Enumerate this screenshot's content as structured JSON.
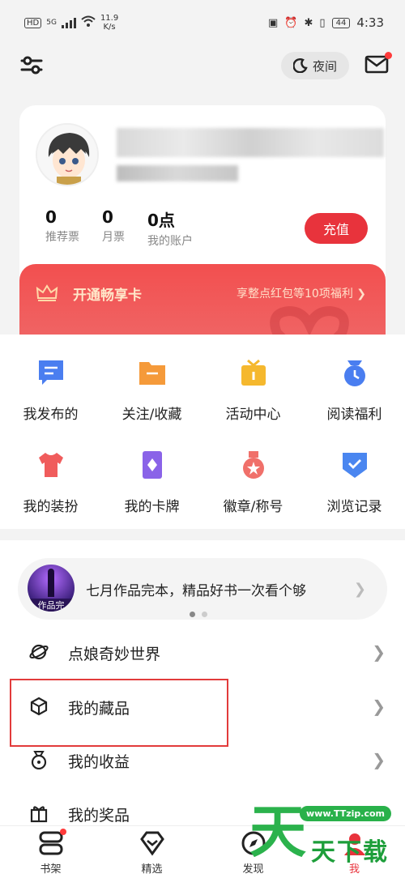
{
  "status_bar": {
    "hd": "HD",
    "network": "5G",
    "speed_value": "11.9",
    "speed_unit": "K/s",
    "battery": "44",
    "time": "4:33"
  },
  "topbar": {
    "night_label": "夜间",
    "mail_has_badge": true
  },
  "profile": {
    "stats": [
      {
        "value": "0",
        "label": "推荐票"
      },
      {
        "value": "0",
        "label": "月票"
      },
      {
        "value": "0点",
        "label": "我的账户"
      }
    ],
    "recharge_label": "充值"
  },
  "vip": {
    "title": "开通畅享卡",
    "desc": "享整点红包等10项福利 ❯"
  },
  "grid": [
    {
      "label": "我发布的",
      "icon": "chat-icon",
      "color": "#4a7ef0"
    },
    {
      "label": "关注/收藏",
      "icon": "folder-icon",
      "color": "#f59a3a"
    },
    {
      "label": "活动中心",
      "icon": "gift-icon",
      "color": "#f5b82e"
    },
    {
      "label": "阅读福利",
      "icon": "clock-bag-icon",
      "color": "#4a7ef0"
    },
    {
      "label": "我的装扮",
      "icon": "tshirt-icon",
      "color": "#f05c5c"
    },
    {
      "label": "我的卡牌",
      "icon": "card-icon",
      "color": "#8a63e8"
    },
    {
      "label": "徽章/称号",
      "icon": "medal-icon",
      "color": "#f0706a"
    },
    {
      "label": "浏览记录",
      "icon": "history-icon",
      "color": "#4a86f0"
    }
  ],
  "promo": {
    "text": "七月作品完本，精品好书一次看个够",
    "img_caption": "作品完"
  },
  "list": [
    {
      "label": "点娘奇妙世界",
      "icon": "planet-icon"
    },
    {
      "label": "我的藏品",
      "icon": "cube-icon"
    },
    {
      "label": "我的收益",
      "icon": "coin-bag-icon"
    },
    {
      "label": "我的奖品",
      "icon": "gift-box-icon"
    }
  ],
  "bottom_nav": [
    {
      "label": "书架",
      "icon": "bookshelf-icon"
    },
    {
      "label": "精选",
      "icon": "diamond-icon"
    },
    {
      "label": "发现",
      "icon": "compass-icon"
    },
    {
      "label": "我",
      "icon": "profile-icon"
    }
  ],
  "watermark": {
    "url": "www.TTzip.com",
    "big": "天",
    "small": "天下载"
  }
}
